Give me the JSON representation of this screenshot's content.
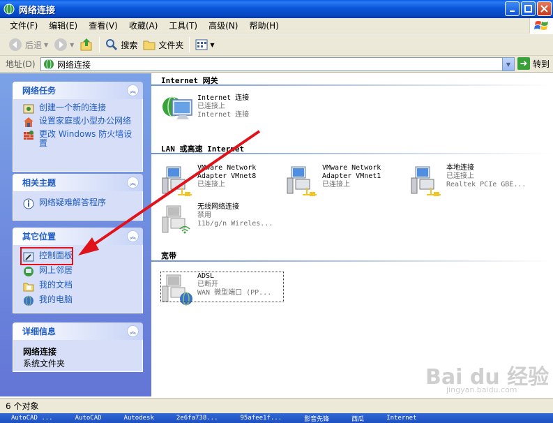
{
  "window": {
    "title": "网络连接"
  },
  "menu": [
    "文件(F)",
    "编辑(E)",
    "查看(V)",
    "收藏(A)",
    "工具(T)",
    "高级(N)",
    "帮助(H)"
  ],
  "toolbar": {
    "back": "后退",
    "search": "搜索",
    "folders": "文件夹"
  },
  "address": {
    "label": "地址(D)",
    "value": "网络连接",
    "go": "转到"
  },
  "panels": {
    "network_tasks": {
      "title": "网络任务",
      "items": [
        "创建一个新的连接",
        "设置家庭或小型办公网络",
        "更改 Windows 防火墙设置"
      ]
    },
    "related": {
      "title": "相关主题",
      "items": [
        "网络疑难解答程序"
      ]
    },
    "other_places": {
      "title": "其它位置",
      "items": [
        "控制面板",
        "网上邻居",
        "我的文档",
        "我的电脑"
      ]
    },
    "details": {
      "title": "详细信息",
      "name": "网络连接",
      "type": "系统文件夹"
    }
  },
  "groups": {
    "internet": {
      "title": "Internet 网关",
      "items": [
        {
          "name": "Internet 连接",
          "status": "已连接上",
          "device": "Internet 连接"
        }
      ]
    },
    "lan": {
      "title": "LAN 或高速 Internet",
      "items": [
        {
          "name1": "VMware Network",
          "name2": "Adapter VMnet8",
          "status": "已连接上"
        },
        {
          "name1": "VMware Network",
          "name2": "Adapter VMnet1",
          "status": "已连接上"
        },
        {
          "name1": "本地连接",
          "name2": "已连接上",
          "status": "Realtek PCIe GBE..."
        },
        {
          "name1": "无线网络连接",
          "name2": "禁用",
          "status": "11b/g/n  Wireles..."
        }
      ]
    },
    "broadband": {
      "title": "宽带",
      "items": [
        {
          "name": "ADSL",
          "status": "已断开",
          "device": "WAN 微型端口 (PP..."
        }
      ]
    }
  },
  "status": {
    "count": "6 个对象"
  },
  "taskbar": [
    "AutoCAD ...",
    "AutoCAD",
    "Autodesk",
    "2e6fa738...",
    "95afee1f...",
    "影音先锋",
    "西瓜",
    "Internet"
  ],
  "watermark": {
    "brand": "Bai du 经验",
    "url": "jingyan.baidu.com"
  },
  "colors": {
    "title_bar": "#0a56d8",
    "task_link": "#215dc6",
    "annotation": "#e0131a"
  }
}
